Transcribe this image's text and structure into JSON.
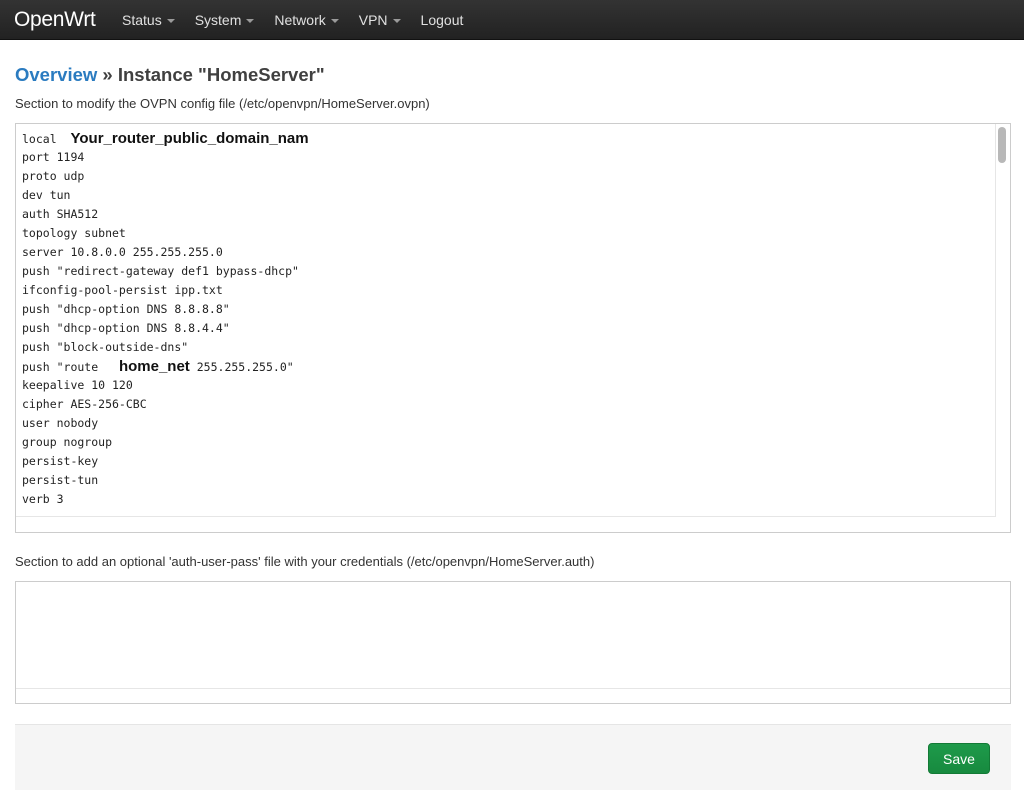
{
  "header": {
    "brand": "OpenWrt",
    "menu": [
      {
        "label": "Status",
        "dropdown": true
      },
      {
        "label": "System",
        "dropdown": true
      },
      {
        "label": "Network",
        "dropdown": true
      },
      {
        "label": "VPN",
        "dropdown": true
      },
      {
        "label": "Logout",
        "dropdown": false
      }
    ]
  },
  "page": {
    "breadcrumb_link": "Overview",
    "breadcrumb_sep": " » ",
    "title": "Instance \"HomeServer\""
  },
  "ovpn_section": {
    "description": "Section to modify the OVPN config file (/etc/openvpn/HomeServer.ovpn)",
    "lines": [
      {
        "pre": "local",
        "ph": "Your_router_public_domain_nam",
        "post": ""
      },
      {
        "pre": "port 1194"
      },
      {
        "pre": "proto udp"
      },
      {
        "pre": "dev tun"
      },
      {
        "pre": "auth SHA512"
      },
      {
        "pre": "topology subnet"
      },
      {
        "pre": "server 10.8.0.0 255.255.255.0"
      },
      {
        "pre": "push \"redirect-gateway def1 bypass-dhcp\""
      },
      {
        "pre": "ifconfig-pool-persist ipp.txt"
      },
      {
        "pre": "push \"dhcp-option DNS 8.8.8.8\""
      },
      {
        "pre": "push \"dhcp-option DNS 8.8.4.4\""
      },
      {
        "pre": "push \"block-outside-dns\""
      },
      {
        "pre": "push \"route",
        "ph": "home_net",
        "post": "255.255.255.0\""
      },
      {
        "pre": "keepalive 10 120"
      },
      {
        "pre": "cipher AES-256-CBC"
      },
      {
        "pre": "user nobody"
      },
      {
        "pre": "group nogroup"
      },
      {
        "pre": "persist-key"
      },
      {
        "pre": "persist-tun"
      },
      {
        "pre": "verb 3"
      }
    ]
  },
  "auth_section": {
    "description": "Section to add an optional 'auth-user-pass' file with your credentials (/etc/openvpn/HomeServer.auth)",
    "value": ""
  },
  "footer": {
    "save_label": "Save"
  },
  "colors": {
    "link": "#2a7bc0",
    "save": "#1e9a4a",
    "topbar": "#2b2b2b"
  }
}
